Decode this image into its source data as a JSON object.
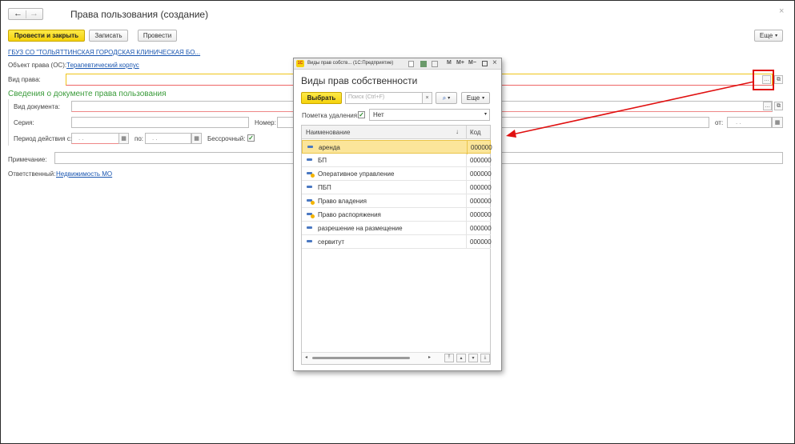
{
  "window": {
    "title": "Права пользования (создание)",
    "close_glyph": "×"
  },
  "nav": {
    "back": "←",
    "forward": "→"
  },
  "toolbar": {
    "post_close": "Провести и закрыть",
    "save": "Записать",
    "post": "Провести",
    "more": "Еще"
  },
  "form": {
    "org_link": "ГБУЗ СО \"ТОЛЬЯТТИНСКАЯ ГОРОДСКАЯ КЛИНИЧЕСКАЯ БО...",
    "object_label": "Объект права (ОС):",
    "object_value": "Терапевтический корпус",
    "right_type_label": "Вид права:",
    "doc_section_title": "Сведения о документе права пользования",
    "doc_type_label": "Вид документа:",
    "series_label": "Серия:",
    "number_label": "Номер:",
    "from_label": "от:",
    "from_mask": ". .",
    "period_label": "Период действия с:",
    "period_from_mask": ". .",
    "period_to_label": "по:",
    "period_to_mask": ". .",
    "indefinite_label": "Бессрочный:",
    "note_label": "Примечание:",
    "responsible_label": "Ответственный:",
    "responsible_value": "Недвижимость МО"
  },
  "modal": {
    "window_title": "Виды прав собств... (1С:Предприятие)",
    "app_badge": "1С",
    "title_buttons": [
      "M",
      "M+",
      "M−"
    ],
    "heading": "Виды прав собственности",
    "select_button": "Выбрать",
    "search_placeholder": "Поиск (Ctrl+F)",
    "more": "Еще",
    "deletion_mark_label": "Пометка удаления:",
    "deletion_mark_value": "Нет",
    "columns": {
      "name": "Наименование",
      "sort_glyph": "↓",
      "code": "Код"
    },
    "rows": [
      {
        "name": "аренда",
        "code": "000000",
        "selected": true,
        "icon": "catalog-item-icon"
      },
      {
        "name": "БП",
        "code": "000000",
        "selected": false,
        "icon": "catalog-item-icon"
      },
      {
        "name": "Оперативное управление",
        "code": "000000",
        "selected": false,
        "icon": "catalog-item-predefined-icon"
      },
      {
        "name": "ПБП",
        "code": "000000",
        "selected": false,
        "icon": "catalog-item-icon"
      },
      {
        "name": "Право владения",
        "code": "000000",
        "selected": false,
        "icon": "catalog-item-predefined-icon"
      },
      {
        "name": "Право распоряжения",
        "code": "000000",
        "selected": false,
        "icon": "catalog-item-predefined-icon"
      },
      {
        "name": "разрешение на размещение",
        "code": "000000",
        "selected": false,
        "icon": "catalog-item-icon"
      },
      {
        "name": "сервитут",
        "code": "000000",
        "selected": false,
        "icon": "catalog-item-icon"
      }
    ]
  },
  "colors": {
    "accent_yellow": "#f5d20c",
    "section_green": "#3a9b3a",
    "link_blue": "#1a56b0",
    "highlight_red": "#e01010",
    "selected_row": "#fbe59a"
  }
}
